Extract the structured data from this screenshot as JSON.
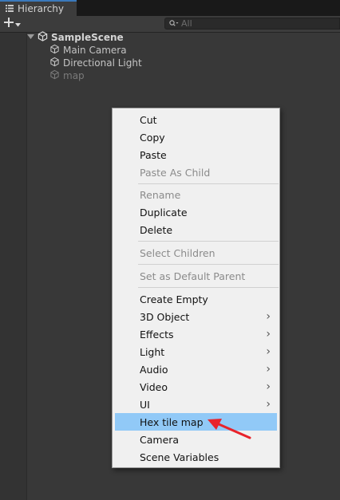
{
  "window": {
    "tab_title": "Hierarchy",
    "tab_icon": "list-icon"
  },
  "toolbar": {
    "add_icon": "plus-icon",
    "search_placeholder": "All",
    "search_icon": "search-icon"
  },
  "hierarchy": {
    "scene": {
      "name": "SampleScene",
      "expanded": true,
      "icon": "unity-logo-icon"
    },
    "objects": [
      {
        "name": "Main Camera",
        "icon": "gameobject-cube-icon",
        "active": true
      },
      {
        "name": "Directional Light",
        "icon": "gameobject-cube-icon",
        "active": true
      },
      {
        "name": "map",
        "icon": "gameobject-cube-icon",
        "active": false
      }
    ]
  },
  "context_menu": {
    "items": [
      {
        "label": "Cut",
        "enabled": true
      },
      {
        "label": "Copy",
        "enabled": true
      },
      {
        "label": "Paste",
        "enabled": true
      },
      {
        "label": "Paste As Child",
        "enabled": false
      },
      {
        "label": "Rename",
        "enabled": false
      },
      {
        "label": "Duplicate",
        "enabled": true
      },
      {
        "label": "Delete",
        "enabled": true
      },
      {
        "label": "Select Children",
        "enabled": false
      },
      {
        "label": "Set as Default Parent",
        "enabled": false
      },
      {
        "label": "Create Empty",
        "enabled": true
      },
      {
        "label": "3D Object",
        "enabled": true,
        "submenu": true
      },
      {
        "label": "Effects",
        "enabled": true,
        "submenu": true
      },
      {
        "label": "Light",
        "enabled": true,
        "submenu": true
      },
      {
        "label": "Audio",
        "enabled": true,
        "submenu": true
      },
      {
        "label": "Video",
        "enabled": true,
        "submenu": true
      },
      {
        "label": "UI",
        "enabled": true,
        "submenu": true
      },
      {
        "label": "Hex tile map",
        "enabled": true,
        "highlighted": true
      },
      {
        "label": "Camera",
        "enabled": true
      },
      {
        "label": "Scene Variables",
        "enabled": true
      }
    ],
    "submenu_glyph": "›"
  },
  "annotation": {
    "icon": "red-arrow-icon",
    "color": "#e8232b"
  },
  "colors": {
    "panel_bg": "#383838",
    "menu_bg": "#f0f0f0",
    "highlight": "#91c9f7",
    "tab_accent": "#3a79bb"
  }
}
